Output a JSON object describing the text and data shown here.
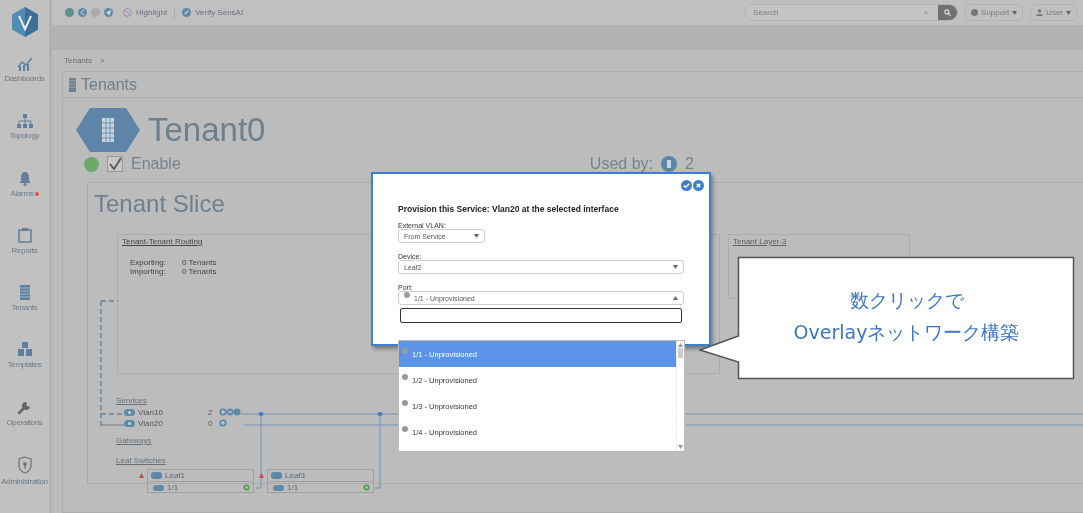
{
  "top_bar": {
    "highlight": "Highlight",
    "verify": "Verify SensAI",
    "search": {
      "placeholder": "Search",
      "clear": "×"
    },
    "support": "Support",
    "user": "User"
  },
  "sidebar": {
    "items": [
      {
        "label": "Dashboards",
        "alert": false
      },
      {
        "label": "Topology",
        "alert": false
      },
      {
        "label": "Alarms",
        "alert": true
      },
      {
        "label": "Reports",
        "alert": false
      },
      {
        "label": "Tenants",
        "alert": false
      },
      {
        "label": "Templates",
        "alert": false
      },
      {
        "label": "Operations",
        "alert": false
      },
      {
        "label": "Administration",
        "alert": false
      }
    ]
  },
  "breadcrumb": {
    "item": "Tenants",
    "separator": ">"
  },
  "page_title": "Tenants",
  "tenant": {
    "name": "Tenant0",
    "enabled": true,
    "enable_label": "Enable",
    "used_by_label": "Used by:",
    "used_by_count": "2"
  },
  "slice": {
    "title": "Tenant Slice",
    "routing": {
      "title": "Tenant-Tenant Routing",
      "rows": [
        {
          "label": "Exporting:",
          "value": "0 Tenants"
        },
        {
          "label": "Importing:",
          "value": "0 Tenants"
        }
      ]
    },
    "layer3": {
      "title": "Tenant Layer-3"
    },
    "services_label": "Services",
    "services": [
      {
        "name": "Vlan10",
        "count": "2"
      },
      {
        "name": "Vlan20",
        "count": "0"
      }
    ],
    "gateways_label": "Gateways",
    "leaf_label": "Leaf Switches",
    "leaves": [
      {
        "name": "Leaf1",
        "port": "1/1"
      },
      {
        "name": "Leaf3",
        "port": "1/1"
      }
    ]
  },
  "modal": {
    "title": "Provision this Service: Vlan20 at the selected interface",
    "external_vlan": {
      "label": "External VLAN:",
      "value": "From Service"
    },
    "device": {
      "label": "Device:",
      "value": "Leaf2"
    },
    "port": {
      "label": "Port:",
      "value": "1/1 - Unprovisioned",
      "options": [
        {
          "label": "1/1 - Unprovisioned",
          "selected": true
        },
        {
          "label": "1/2 - Unprovisioned",
          "selected": false
        },
        {
          "label": "1/3 - Unprovisioned",
          "selected": false
        },
        {
          "label": "1/4 - Unprovisioned",
          "selected": false
        }
      ]
    }
  },
  "callout": {
    "lines": [
      "数クリックで",
      "Overlayネットワーク構築"
    ]
  }
}
